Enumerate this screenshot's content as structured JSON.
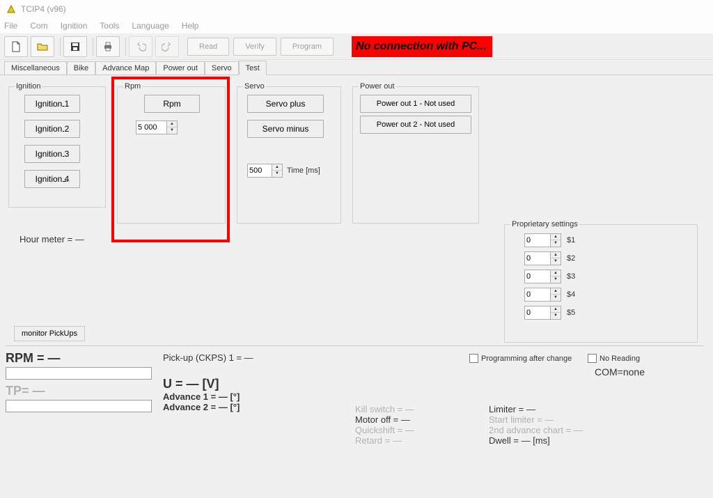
{
  "window": {
    "title": "TCIP4 (v96)"
  },
  "menu": {
    "file": "File",
    "com": "Com",
    "ignition": "Ignition",
    "tools": "Tools",
    "language": "Language",
    "help": "Help"
  },
  "toolbar": {
    "read": "Read",
    "verify": "Verify",
    "program": "Program"
  },
  "banner": "No connection with PC...",
  "tabs": {
    "misc": "Miscellaneous",
    "bike": "Bike",
    "advmap": "Advance Map",
    "powerout": "Power out",
    "servo": "Servo",
    "test": "Test"
  },
  "ignition": {
    "legend": "Ignition",
    "ign1": "Ignition 1",
    "ign2": "Ignition 2",
    "ign3": "Ignition 3",
    "ign4": "Ignition 4"
  },
  "rpm": {
    "legend": "Rpm",
    "button": "Rpm",
    "value": "5 000"
  },
  "servo": {
    "legend": "Servo",
    "plus": "Servo plus",
    "minus": "Servo minus",
    "time_value": "500",
    "time_label": "Time [ms]"
  },
  "powerout": {
    "legend": "Power out",
    "p1": "Power out 1 - Not used",
    "p2": "Power out 2 - Not used"
  },
  "hourmeter": "Hour meter = —",
  "monitor": "monitor PickUps",
  "proprietary": {
    "legend": "Proprietary settings",
    "rows": [
      {
        "val": "0",
        "lbl": "$1"
      },
      {
        "val": "0",
        "lbl": "$2"
      },
      {
        "val": "0",
        "lbl": "$3"
      },
      {
        "val": "0",
        "lbl": "$4"
      },
      {
        "val": "0",
        "lbl": "$5"
      }
    ]
  },
  "status": {
    "rpm": "RPM = —",
    "tp": "TP= —",
    "pickup": "Pick-up (CKPS) 1 =  —",
    "u": "U = — [V]",
    "adv1": "Advance 1 = — [°]",
    "adv2": "Advance 2 = — [°]",
    "kill": "Kill switch = —",
    "motoroff": "Motor off = —",
    "quick": "Quickshift = —",
    "retard": "Retard = —",
    "limiter": "Limiter = —",
    "startlim": "Start limiter = —",
    "adv2chart": "2nd advance chart = —",
    "dwell": "Dwell = — [ms]",
    "prog_after": "Programming after change",
    "no_reading": "No Reading",
    "com": "COM=none"
  }
}
